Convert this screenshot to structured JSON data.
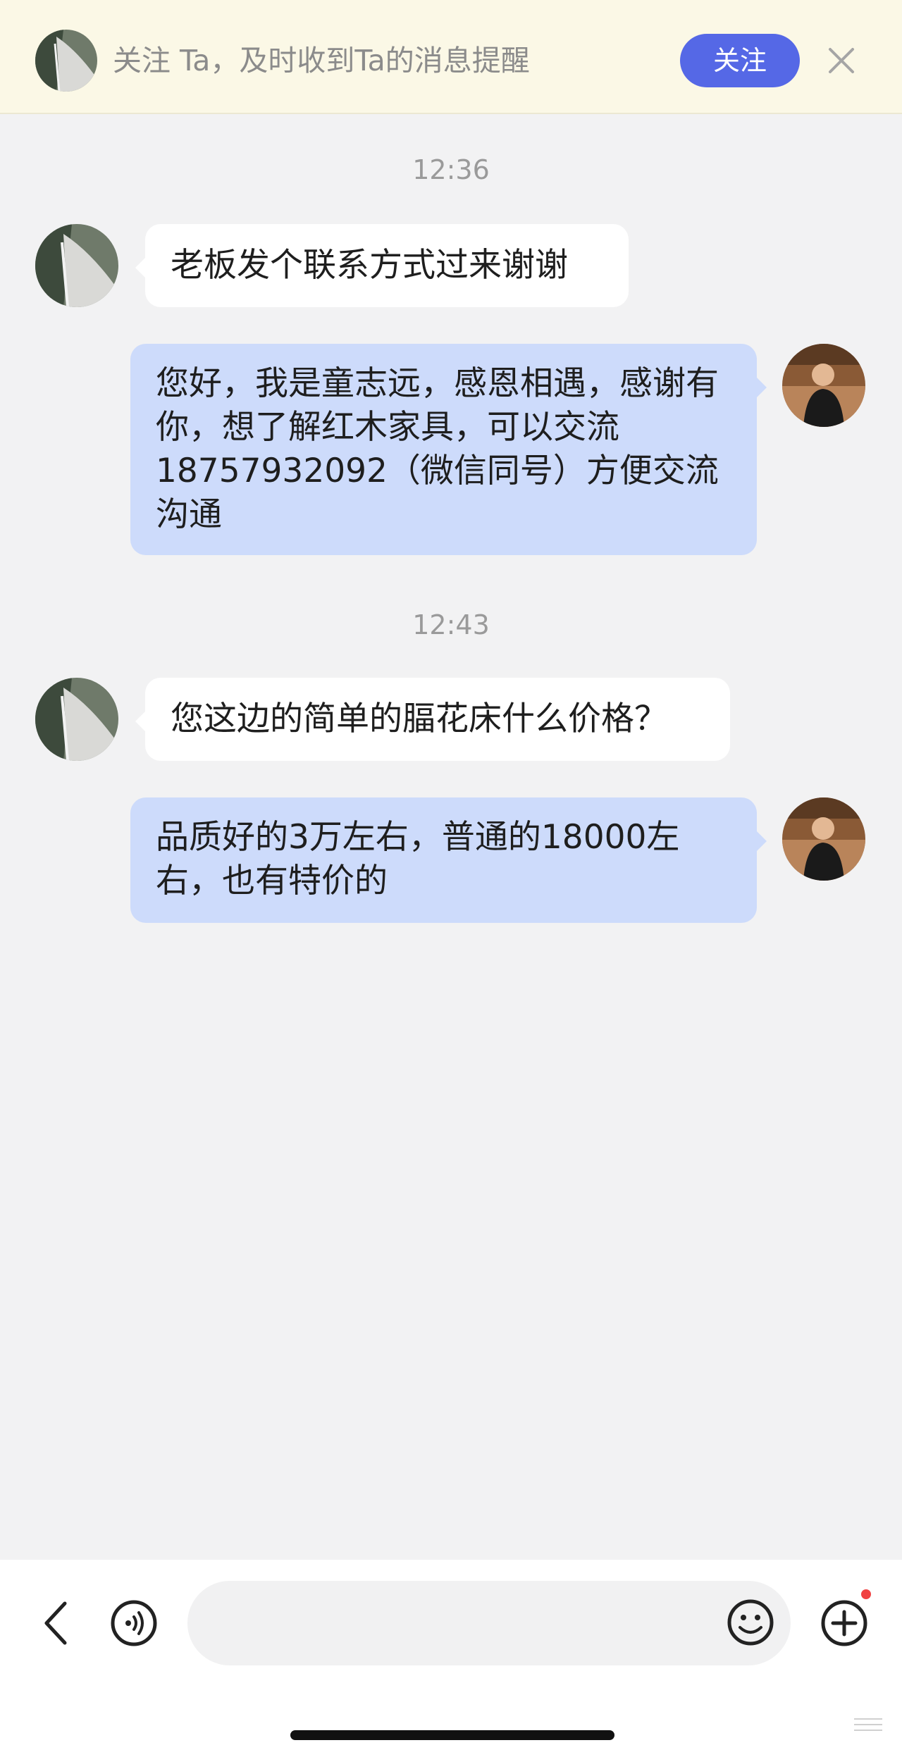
{
  "banner": {
    "text": "关注 Ta，及时收到Ta的消息提醒",
    "follow_label": "关注",
    "avatar_icon": "contact-avatar-icon",
    "close_icon": "close-icon"
  },
  "chat": {
    "groups": [
      {
        "time": "12:36",
        "messages": [
          {
            "sender": "contact",
            "text": "老板发个联系方式过来谢谢"
          },
          {
            "sender": "me",
            "text": "您好，我是童志远，感恩相遇，感谢有你，想了解红木家具，可以交流18757932092（微信同号）方便交流沟通"
          }
        ]
      },
      {
        "time": "12:43",
        "messages": [
          {
            "sender": "contact",
            "text": "您这边的简单的腷花床什么价格？"
          },
          {
            "sender": "me",
            "text": "品质好的3万左右，普通的18000左右，也有特价的"
          }
        ]
      }
    ]
  },
  "input_bar": {
    "placeholder": "",
    "icons": [
      "back-icon",
      "voice-icon",
      "emoji-icon",
      "plus-icon"
    ],
    "has_notification_dot": true
  },
  "colors": {
    "banner_bg": "#fbf8e6",
    "follow_button": "#5568e6",
    "sent_bubble": "#cddbfb",
    "received_bubble": "#ffffff",
    "page_bg": "#f2f2f3",
    "notification_dot": "#f04141"
  }
}
